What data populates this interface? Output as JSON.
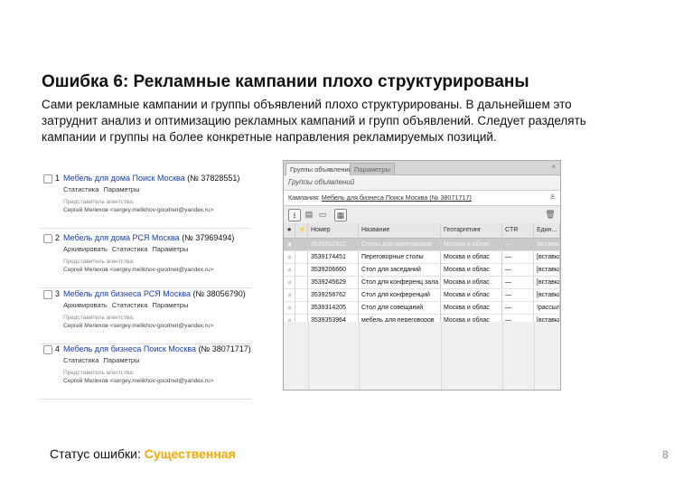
{
  "slide": {
    "title": "Ошибка 6: Рекламные кампании плохо структурированы",
    "description_lines": [
      "Сами рекламные кампании и группы объявлений плохо структурированы. В дальнейшем это",
      "затруднит анализ и оптимизацию рекламных кампаний и групп объявлений. Следует разделять",
      "кампании и группы на более конкретные направления рекламируемых позиций."
    ],
    "status_label": "Статус ошибки:",
    "status_value": "Существенная",
    "status_color": "#f2a900",
    "page_number": "8"
  },
  "campaigns": [
    {
      "num": "1",
      "name": "Мебель для дома Поиск Москва",
      "id": "(№ 37828551)",
      "links": [
        "Статистика",
        "Параметры"
      ],
      "agency_label": "Представитель агентства:",
      "agency": "Сергей Мелихов <sergey.melikhov-goodnet@yandex.ru>"
    },
    {
      "num": "2",
      "name": "Мебель для дома РСЯ Москва",
      "id": "(№ 37969494)",
      "links": [
        "Архивировать",
        "Статистика",
        "Параметры"
      ],
      "agency_label": "Представитель агентства:",
      "agency": "Сергей Мелихов <sergey.melikhov-goodnet@yandex.ru>"
    },
    {
      "num": "3",
      "name": "Мебель для бизнеса РСЯ Москва",
      "id": "(№ 38056790)",
      "links": [
        "Архивировать",
        "Статистика",
        "Параметры"
      ],
      "agency_label": "Представитель агентства:",
      "agency": "Сергей Мелихов <sergey.melikhov-goodnet@yandex.ru>"
    },
    {
      "num": "4",
      "name": "Мебель для бизнеса Поиск Москва",
      "id": "(№ 38071717)",
      "links": [
        "Статистика",
        "Параметры"
      ],
      "agency_label": "Представитель агентства:",
      "agency": "Сергей Мелихов <sergey.melikhov-goodnet@yandex.ru>"
    }
  ],
  "window": {
    "tab_active": "Группы объявлений",
    "tab_inactive": "Параметры",
    "title": "Группы объявлений",
    "campaign_label": "Кампания:",
    "campaign_value": "Мебель для бизнеса Поиск Москва (№ 38071717)",
    "columns": [
      "★",
      "⚡",
      "Номер",
      "Название",
      "Геотаргетинг",
      "CTR",
      "Един..."
    ],
    "rows": [
      {
        "num": "3535562912",
        "name": "Столы для переговоров",
        "geo": "Москва и облас",
        "ctr": "—",
        "unit": "[вставка"
      },
      {
        "num": "3539174451",
        "name": "Переговорные столы",
        "geo": "Москва и облас",
        "ctr": "—",
        "unit": "[вставка"
      },
      {
        "num": "3539206660",
        "name": "Стол для заседаний",
        "geo": "Москва и облас",
        "ctr": "—",
        "unit": "[вставка"
      },
      {
        "num": "3539245629",
        "name": "Стол для конференц зала",
        "geo": "Москва и облас",
        "ctr": "—",
        "unit": "[вставка"
      },
      {
        "num": "3539256762",
        "name": "Стол для конференций",
        "geo": "Москва и облас",
        "ctr": "—",
        "unit": "[вставка"
      },
      {
        "num": "3539314205",
        "name": "Стол для совещаний",
        "geo": "Москва и облас",
        "ctr": "—",
        "unit": "!рассыл"
      },
      {
        "num": "3539353964",
        "name": "мебель для переговоров",
        "geo": "Москва и облас",
        "ctr": "—",
        "unit": "[вставка"
      }
    ]
  }
}
